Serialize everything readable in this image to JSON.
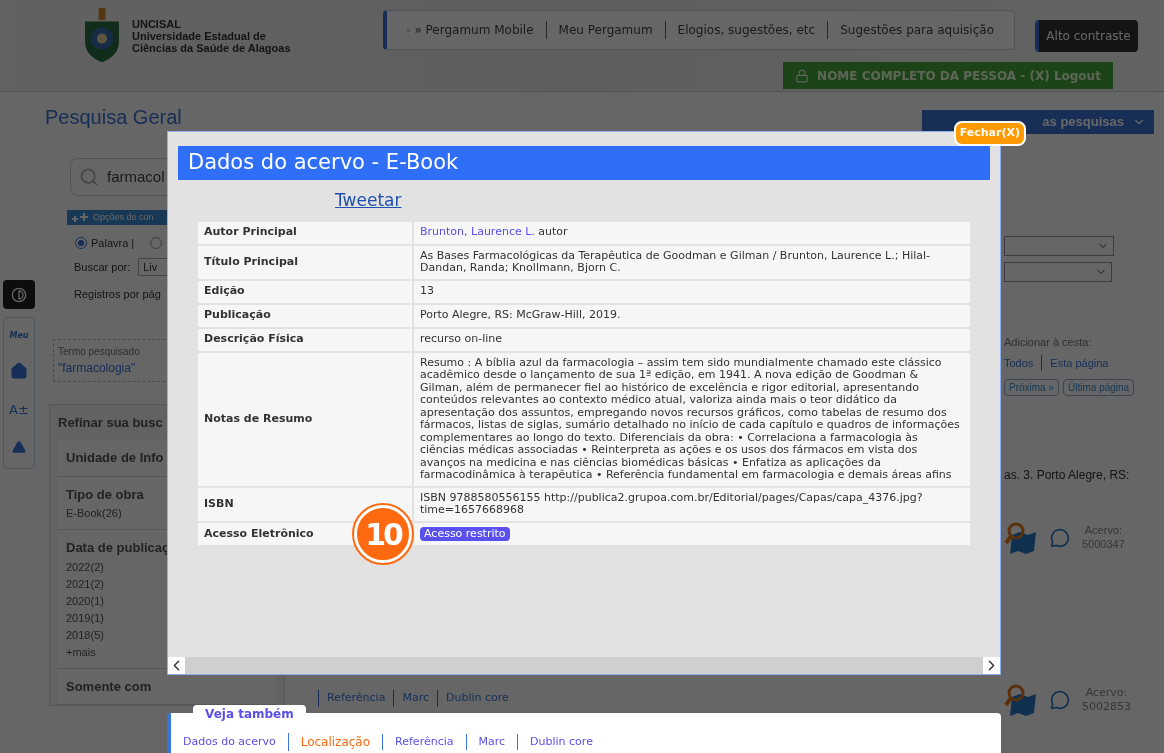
{
  "header": {
    "institution": [
      "UNCISAL",
      "Universidade Estadual de",
      "Ciências da Saúde de Alagoas"
    ],
    "links": [
      "» Pergamum Mobile",
      "Meu Pergamum",
      "Elogios, sugestões, etc",
      "Sugestões para aquisição"
    ],
    "contrast_button": "Alto contraste",
    "user_button": "NOME COMPLETO DA PESSOA - (X) Logout"
  },
  "side_tools": {
    "my_label": "Meu",
    "font_size": "A±"
  },
  "search": {
    "title": "Pesquisa Geral",
    "query": "farmacol",
    "options_label": "Opções de con",
    "modes": [
      {
        "label": "Palavra |",
        "selected": true
      },
      {
        "selected": false
      }
    ],
    "search_by_label": "Buscar por:",
    "search_by_value": "Liv",
    "per_page_label": "Registros por pág",
    "saved_searches": "as pesquisas"
  },
  "term": {
    "label": "Termo pesquisado",
    "value": "\"farmacologia\""
  },
  "refine": {
    "title": "Refinar sua busc",
    "groups": [
      {
        "title": "Unidade de Info"
      },
      {
        "title": "Tipo de obra",
        "items": [
          "E-Book(26)"
        ]
      },
      {
        "title": "Data de publicaç",
        "items": [
          "2022(2)",
          "2021(2)",
          "2020(1)",
          "2019(1)",
          "2018(5)",
          "+mais"
        ]
      },
      {
        "title": "Somente com"
      }
    ]
  },
  "cart": {
    "label": "Adicionar à cesta:",
    "links": [
      "Todos",
      "Esta página"
    ],
    "paging": [
      "Próxima »",
      "Última página"
    ]
  },
  "results": [
    {
      "text": "as. 3. Porto Alegre, RS:",
      "acervo_label": "Acervo:",
      "acervo": "5000347"
    },
    {
      "links": [
        "Referência",
        "Marc",
        "Dublin core"
      ],
      "acervo_label": "Acervo:",
      "acervo": "5002853"
    }
  ],
  "modal": {
    "title": "Dados do acervo - E-Book",
    "close": "Fechar(X)",
    "tweet": "Tweetar",
    "annotation": "10",
    "rows": [
      {
        "label": "Autor Principal",
        "kind": "author",
        "link": "Brunton, Laurence L.",
        "value": "autor"
      },
      {
        "label": "Título Principal",
        "kind": "text",
        "value": "As Bases Farmacológicas da Terapêutica de Goodman e Gilman / Brunton, Laurence L.; Hilal-Dandan, Randa; Knollmann, Bjorn C."
      },
      {
        "label": "Edição",
        "kind": "text",
        "value": "13"
      },
      {
        "label": "Publicação",
        "kind": "text",
        "value": "Porto Alegre, RS: McGraw-Hill, 2019."
      },
      {
        "label": "Descrição Física",
        "kind": "text",
        "value": "recurso on-line"
      },
      {
        "label": "Notas de Resumo",
        "kind": "text",
        "value": "Resumo : A bíblia azul da farmacologia – assim tem sido mundialmente chamado este clássico acadêmico desde o lançamento de sua 1ª edição, em 1941.  A nova edição de Goodman & Gilman, além de permanecer fiel ao histórico de excelência e rigor editorial, apresentando conteúdos relevantes ao contexto médico atual, valoriza ainda mais o teor didático da apresentação dos assuntos, empregando novos recursos gráficos, como tabelas de resumo dos fármacos, listas de siglas, sumário detalhado no início de cada capítulo e quadros de informações complementares ao longo do texto. Diferenciais da obra: •  Correlaciona a farmacologia às ciências médicas associadas •  Reinterpreta as ações e os usos dos fármacos em vista dos avanços  na medicina e nas ciências biomédicas básicas •  Enfatiza as aplicações da farmacodinâmica à terapêutica •  Referência fundamental em farmacologia e demais áreas afins"
      },
      {
        "label": "ISBN",
        "kind": "text",
        "value": "ISBN 9788580556155  http://publica2.grupoa.com.br/Editorial/pages/Capas/capa_4376.jpg?time=1657668968"
      },
      {
        "label": "Acesso Eletrônico",
        "kind": "badge",
        "value": "Acesso restrito"
      }
    ]
  },
  "see_also": {
    "title": "Veja também",
    "links": [
      {
        "label": "Dados do acervo",
        "selected": false
      },
      {
        "label": "Localização",
        "selected": true
      },
      {
        "label": "Referência",
        "selected": false
      },
      {
        "label": "Marc",
        "selected": false
      },
      {
        "label": "Dublin core",
        "selected": false
      }
    ]
  }
}
